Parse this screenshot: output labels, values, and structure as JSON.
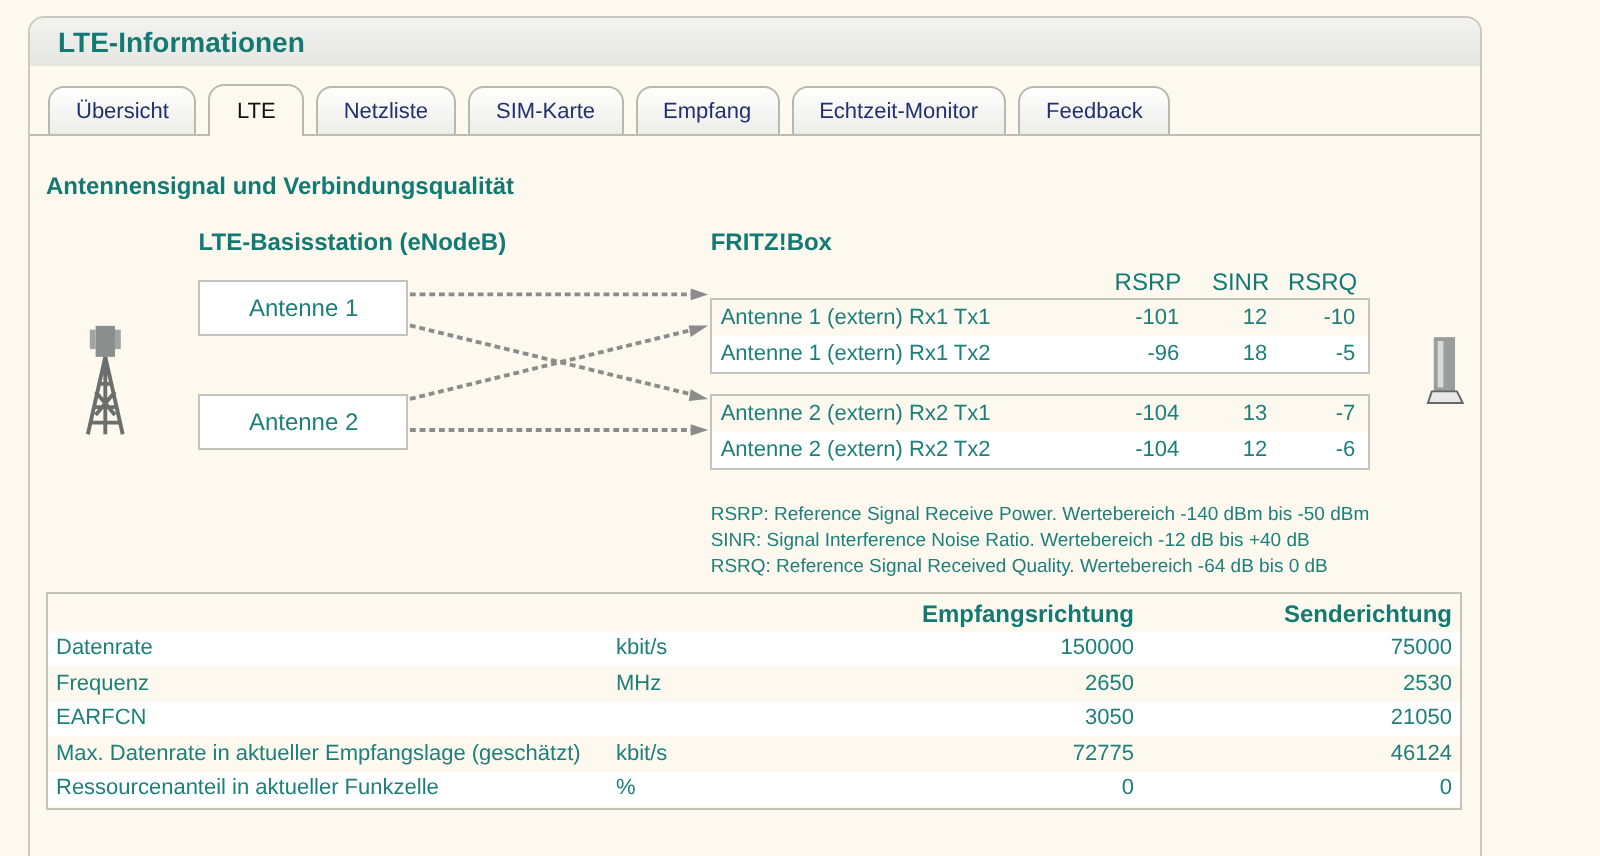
{
  "panel": {
    "title": "LTE-Informationen"
  },
  "tabs": [
    {
      "label": "Übersicht",
      "selected": false
    },
    {
      "label": "LTE",
      "selected": true
    },
    {
      "label": "Netzliste",
      "selected": false
    },
    {
      "label": "SIM-Karte",
      "selected": false
    },
    {
      "label": "Empfang",
      "selected": false
    },
    {
      "label": "Echtzeit-Monitor",
      "selected": false
    },
    {
      "label": "Feedback",
      "selected": false
    }
  ],
  "section_title": "Antennensignal und Verbindungsqualität",
  "diagram": {
    "base_station_title": "LTE-Basisstation (eNodeB)",
    "antennas": [
      "Antenne 1",
      "Antenne 2"
    ],
    "fritzbox_title": "FRITZ!Box",
    "columns": [
      "RSRP",
      "SINR",
      "RSRQ"
    ],
    "groups": [
      [
        {
          "name": "Antenne 1 (extern) Rx1 Tx1",
          "values": [
            "-101",
            "12",
            "-10"
          ]
        },
        {
          "name": "Antenne 1 (extern) Rx1 Tx2",
          "values": [
            "-96",
            "18",
            "-5"
          ]
        }
      ],
      [
        {
          "name": "Antenne 2 (extern) Rx2 Tx1",
          "values": [
            "-104",
            "13",
            "-7"
          ]
        },
        {
          "name": "Antenne 2 (extern) Rx2 Tx2",
          "values": [
            "-104",
            "12",
            "-6"
          ]
        }
      ]
    ],
    "legend": [
      "RSRP: Reference Signal Receive Power. Wertebereich -140 dBm bis -50 dBm",
      "SINR: Signal Interference Noise Ratio. Wertebereich -12 dB bis +40 dB",
      "RSRQ: Reference Signal Received Quality. Wertebereich -64 dB bis 0 dB"
    ]
  },
  "table": {
    "receive_header": "Empfangsrichtung",
    "send_header": "Senderichtung",
    "rows": [
      {
        "label": "Datenrate",
        "unit": "kbit/s",
        "receive": "150000",
        "send": "75000"
      },
      {
        "label": "Frequenz",
        "unit": "MHz",
        "receive": "2650",
        "send": "2530"
      },
      {
        "label": "EARFCN",
        "receive": "3050",
        "send": "21050"
      },
      {
        "label": "Max. Datenrate in aktueller Empfangslage (geschätzt)",
        "unit": "kbit/s",
        "receive": "72775",
        "send": "46124"
      },
      {
        "label": "Ressourcenanteil in aktueller Funkzelle",
        "unit": "%",
        "receive": "0",
        "send": "0"
      }
    ]
  }
}
